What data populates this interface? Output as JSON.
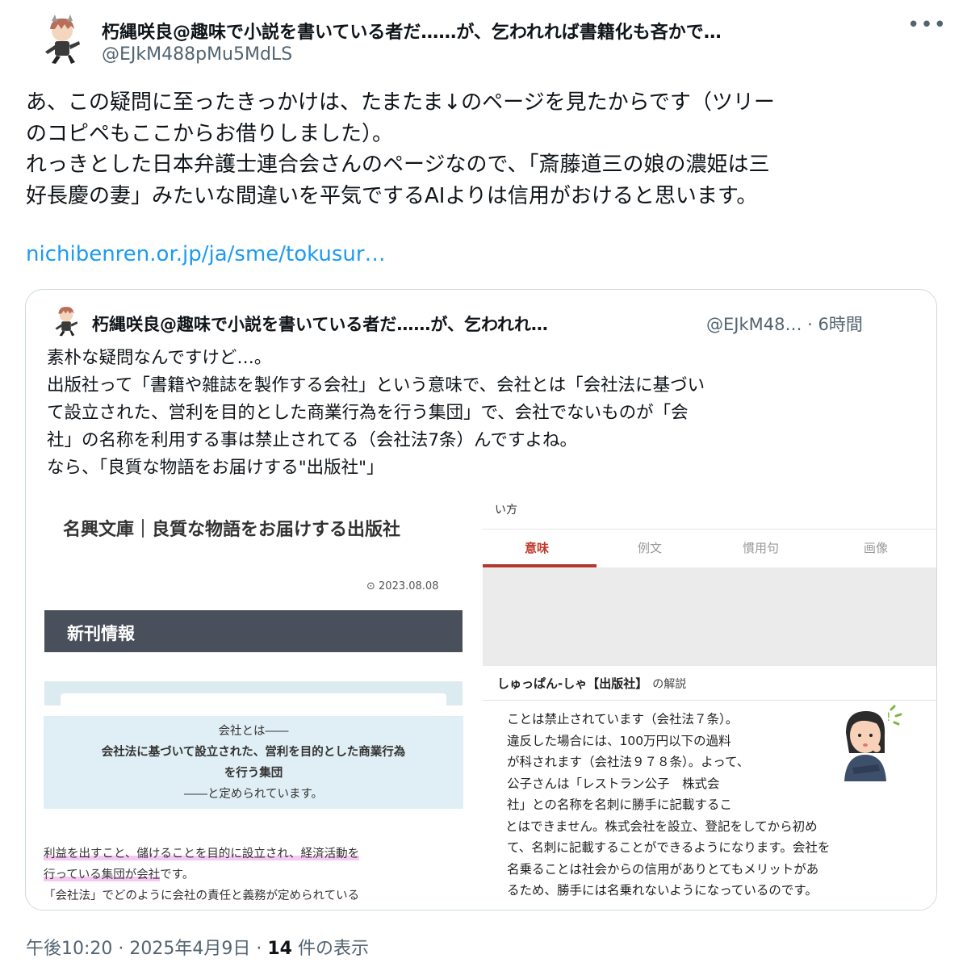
{
  "tweet": {
    "author_name": "朽縄咲良@趣味で小説を書いている者だ……が、乞われれば書籍化も吝かで…",
    "handle": "@EJkM488pMu5MdLS",
    "more_label": "•••",
    "text_lines": [
      "あ、この疑問に至ったきっかけは、たまたま↓のページを見たからです（ツリー",
      "のコピペもここからお借りしました）。",
      "れっきとした日本弁護士連合会さんのページなので、「斎藤道三の娘の濃姫は三",
      "好長慶の妻」みたいな間違いを平気でするAIよりは信用がおけると思います。"
    ],
    "link": "nichibenren.or.jp/ja/sme/tokusur…",
    "footer": {
      "time": "午後10:20",
      "sep1": " · ",
      "date": "2025年4月9日",
      "sep2": " · ",
      "views_count": "14",
      "views_label": " 件の表示"
    }
  },
  "quote": {
    "author_name": "朽縄咲良@趣味で小説を書いている者だ……が、乞われれ…",
    "handle_time": "@EJkM48… · 6時間",
    "text_lines": [
      "素朴な疑問なんですけど…。",
      "出版社って「書籍や雑誌を製作する会社」という意味で、会社とは「会社法に基づい",
      "て設立された、営利を目的とした商業行為を行う集団」で、会社でないものが「会",
      "社」の名称を利用する事は禁止されてる（会社法7条）んですよね。",
      "なら、「良質な物語をお届けする\"出版社\"」"
    ],
    "image_left": {
      "title": "名興文庫｜良質な物語をお届けする出版社",
      "date": "2023.08.08",
      "bar_label": "新刊情報",
      "box_line1": "会社とは――",
      "box_line2": "会社法に基づいて設立された、営利を目的とした商業行為",
      "box_line3": "を行う集団",
      "box_line4": "――と定められています。",
      "text_line1": "利益を出すこと、儲けることを目的に設立され、経済活動を",
      "text_line2a": "行っている集団が会社",
      "text_line2b": "です。",
      "text_line3": "「会社法」でどのように会社の責任と義務が定められている"
    },
    "image_right": {
      "top_text": "い方",
      "tabs": [
        "意味",
        "例文",
        "慣用句",
        "画像"
      ],
      "heading_word": "しゅっぱん-しゃ【出版社】",
      "heading_suffix": "の解説",
      "body_lines": [
        "ことは禁止されています（会社法７条）。",
        "違反した場合には、100万円以下の過料",
        "が科されます（会社法９７８条）。よって、",
        "公子さんは「レストラン公子　株式会",
        "社」との名称を名刺に勝手に記載するこ",
        "とはできません。株式会社を設立、登記をしてから初め",
        "て、名刺に記載することができるようになります。会社を",
        "名乗ることは社会からの信用がありとてもメリットがあ",
        "るため、勝手には名乗れないようになっているのです。"
      ]
    }
  },
  "colors": {
    "link": "#1d9bf0",
    "secondary_text": "#536471",
    "tab_active": "#c0392b",
    "highlight": "#f6c8f2",
    "bar": "#4a4f5c"
  },
  "icons": [
    "avatar",
    "more-icon",
    "clock-icon",
    "thinking-woman-illustration"
  ]
}
